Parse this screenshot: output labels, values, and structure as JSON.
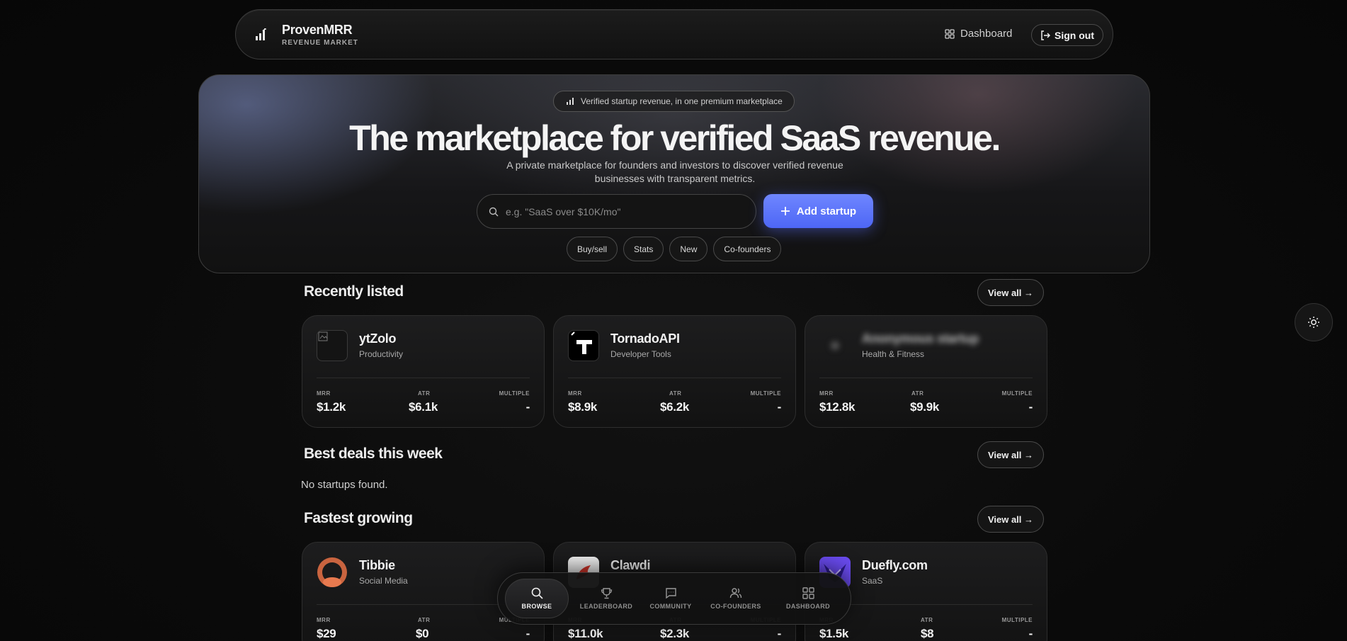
{
  "header": {
    "brand_title": "ProvenMRR",
    "brand_subtitle": "REVENUE MARKET",
    "dashboard_label": "Dashboard",
    "signout_label": "Sign out"
  },
  "hero": {
    "pill_text": "Verified startup revenue, in one premium marketplace",
    "title": "The marketplace for verified SaaS revenue.",
    "description": "A private marketplace for founders and investors to discover verified revenue businesses with transparent metrics.",
    "search_placeholder": "e.g. \"SaaS over $10K/mo\"",
    "add_button_label": "Add startup",
    "chips": [
      "Buy/sell",
      "Stats",
      "New",
      "Co-founders"
    ]
  },
  "metric_labels": {
    "mrr": "MRR",
    "atr": "ATR",
    "multiple": "MULTIPLE"
  },
  "recently_listed": {
    "title": "Recently listed",
    "view_all": "View all →",
    "cards": [
      {
        "name": "ytZolo",
        "category": "Productivity",
        "mrr": "$1.2k",
        "atr": "$6.1k",
        "multiple": "-"
      },
      {
        "name": "TornadoAPI",
        "category": "Developer Tools",
        "mrr": "$8.9k",
        "atr": "$6.2k",
        "multiple": "-"
      },
      {
        "name": "Anonymous startup",
        "category": "Health & Fitness",
        "mrr": "$12.8k",
        "atr": "$9.9k",
        "multiple": "-"
      }
    ]
  },
  "best_deals": {
    "title": "Best deals this week",
    "view_all": "View all →",
    "empty_text": "No startups found."
  },
  "fastest_growing": {
    "title": "Fastest growing",
    "view_all": "View all →",
    "cards": [
      {
        "name": "Tibbie",
        "category": "Social Media",
        "mrr": "$29",
        "atr": "$0",
        "multiple": "-"
      },
      {
        "name": "Clawdi",
        "category": "",
        "mrr": "$11.0k",
        "atr": "$2.3k",
        "multiple": "-"
      },
      {
        "name": "Duefly.com",
        "category": "SaaS",
        "mrr": "$1.5k",
        "atr": "$8",
        "multiple": "-"
      }
    ]
  },
  "bottom_nav": {
    "items": [
      "BROWSE",
      "LEADERBOARD",
      "COMMUNITY",
      "CO-FOUNDERS",
      "DASHBOARD"
    ]
  },
  "colors": {
    "accent": "#5b73fb",
    "background": "#0a0a0a"
  }
}
